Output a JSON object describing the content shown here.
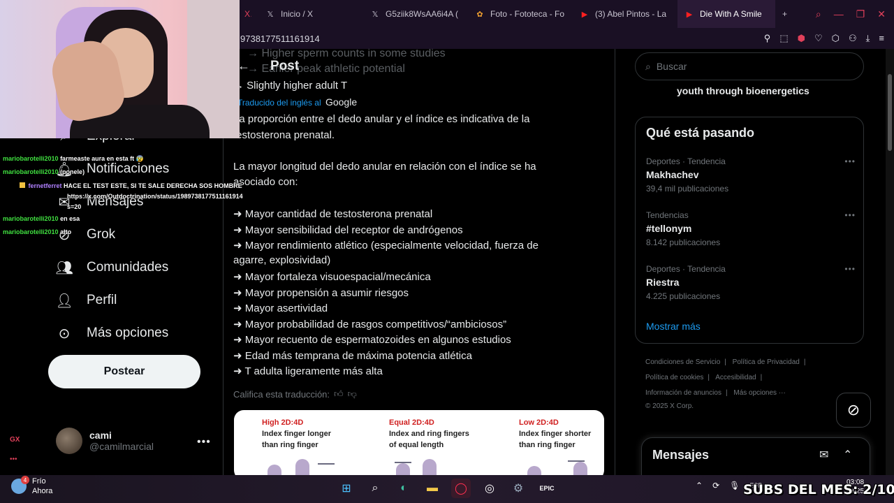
{
  "browser": {
    "tabs": [
      {
        "icon": "x-logo-icon",
        "label": "X:"
      },
      {
        "icon": "x-logo-icon",
        "label": "Inicio / X"
      },
      {
        "icon": "x-logo-icon",
        "label": "G5ziik8WsAA6i4A ("
      },
      {
        "icon": "photos-icon",
        "label": "Foto - Fototeca - Fo"
      },
      {
        "icon": "youtube-icon",
        "label": "(3) Abel Pintos - La"
      },
      {
        "icon": "youtube-icon",
        "label": "Die With A Smile"
      }
    ],
    "new_tab": "+",
    "address_fragment": "9738177511161914"
  },
  "sidebar": {
    "nav": [
      {
        "icon": "search-icon",
        "label": "Explorar"
      },
      {
        "icon": "bell-icon",
        "label": "Notificaciones"
      },
      {
        "icon": "mail-icon",
        "label": "Mensajes"
      },
      {
        "icon": "grok-icon",
        "label": "Grok"
      },
      {
        "icon": "communities-icon",
        "label": "Comunidades"
      },
      {
        "icon": "profile-icon",
        "label": "Perfil"
      },
      {
        "icon": "more-options-icon",
        "label": "Más opciones"
      }
    ],
    "post_button": "Postear",
    "account": {
      "name": "cami",
      "handle": "@camilmarcial",
      "more": "•••"
    }
  },
  "chat": [
    {
      "user": "mariobarotelli2010",
      "message": "farmeaste aura en esta ft 😰"
    },
    {
      "user": "mariobarotelli2010",
      "message": "(ponele)"
    },
    {
      "user": "fernetferret",
      "message": "HACE EL TEST ESTE, SI TE SALE DERECHA SOS HOMBRE"
    },
    {
      "user": "",
      "message": "https://x.com/Outdoctrination/status/1989738177511161914"
    },
    {
      "user": "",
      "message": "s=20"
    },
    {
      "user": "mariobarotelli2010",
      "message": "en esa"
    },
    {
      "user": "mariobarotelli2010",
      "message": "alto"
    }
  ],
  "post": {
    "header_title": "Post",
    "ghost_lines": [
      "→ Higher sperm counts in some studies",
      "→ Earlier peak athletic potential"
    ],
    "last_original_line": "→ Slightly higher adult T",
    "translated_label": "Traducido del inglés al",
    "translated_engine": "Google",
    "lines": [
      "La proporción entre el dedo anular y el índice es indicativa de la",
      "testosterona prenatal.",
      "La mayor longitud del dedo anular en relación con el índice se ha",
      "asociado con:",
      "➜ Mayor cantidad de testosterona prenatal",
      "➜ Mayor sensibilidad del receptor de andrógenos",
      "➜ Mayor rendimiento atlético (especialmente velocidad, fuerza de",
      "agarre, explosividad)",
      "➜ Mayor fortaleza visuoespacial/mecánica",
      "➜ Mayor propensión a asumir riesgos",
      "➜ Mayor asertividad",
      "➜ Mayor probabilidad de rasgos competitivos/“ambiciosos”",
      "➜ Mayor recuento de espermatozoides en algunos estudios",
      "➜ Edad más temprana de máxima potencia atlética",
      "➜ T adulta ligeramente más alta"
    ],
    "rate_translation": "Califica esta traducción:",
    "image": {
      "columns": [
        {
          "heading": "High 2D:4D",
          "desc1": "Index finger longer",
          "desc2": "than ring finger"
        },
        {
          "heading": "Equal 2D:4D",
          "desc1": "Index and ring fingers",
          "desc2": "of equal length"
        },
        {
          "heading": "Low 2D:4D",
          "desc1": "Index finger shorter",
          "desc2": "than ring finger"
        }
      ]
    }
  },
  "right": {
    "search_placeholder": "Buscar",
    "prev_trend": "youth through bioenergetics",
    "trends_title": "Qué está pasando",
    "trends": [
      {
        "meta": "Deportes · Tendencia",
        "name": "Makhachev",
        "count": "39,4 mil publicaciones"
      },
      {
        "meta": "Tendencias",
        "name": "#tellonym",
        "count": "8.142 publicaciones"
      },
      {
        "meta": "Deportes · Tendencia",
        "name": "Riestra",
        "count": "4.225 publicaciones"
      }
    ],
    "show_more": "Mostrar más",
    "footer": {
      "row1": [
        "Condiciones de Servicio",
        "Política de Privacidad"
      ],
      "row2": [
        "Política de cookies",
        "Accesibilidad"
      ],
      "row3": [
        "Información de anuncios",
        "Más opciones ···"
      ],
      "copyright": "© 2025 X Corp."
    },
    "messages_title": "Mensajes"
  },
  "taskbar": {
    "weather": "Frío",
    "weather_sub": "Ahora",
    "weather_badge": "4",
    "lang": "ESP",
    "time": "03:08",
    "date": "2025"
  },
  "overlay": {
    "subs": "SUBS DEL MES: 2/10",
    "gx": "GX",
    "gx_dots": "•••"
  }
}
